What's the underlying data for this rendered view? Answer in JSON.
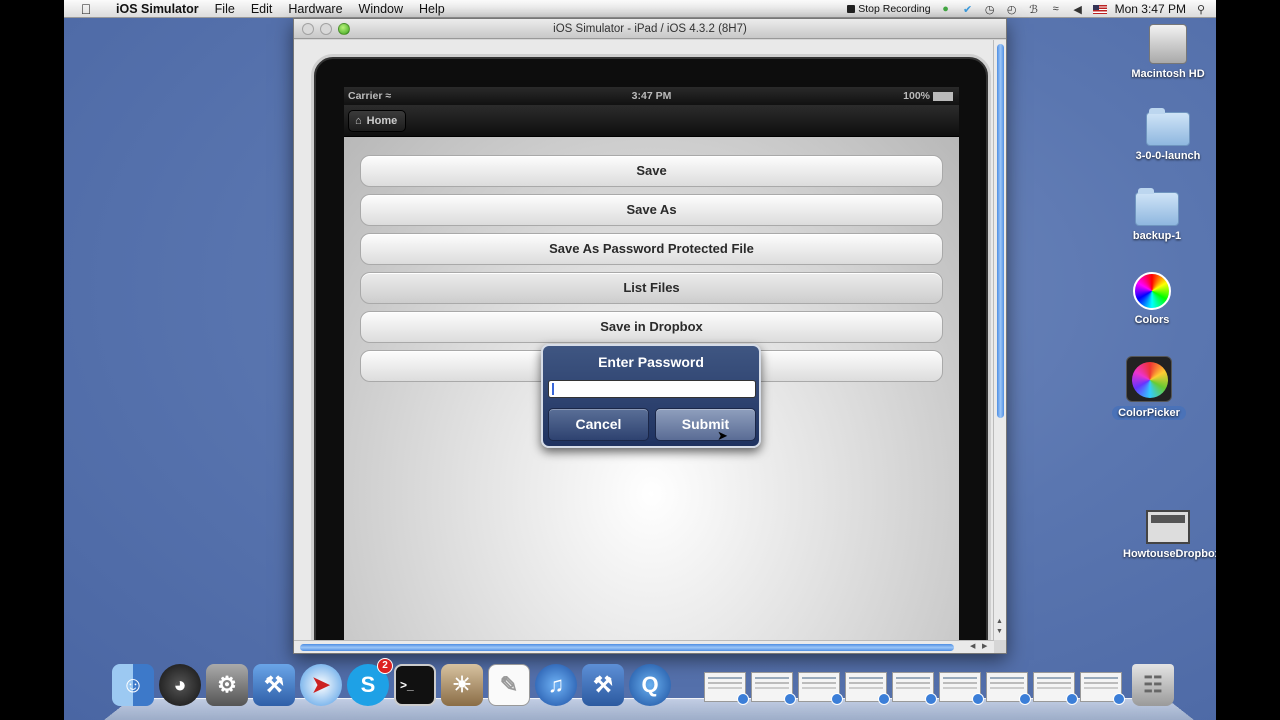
{
  "menubar": {
    "app_name": "iOS Simulator",
    "items": [
      "File",
      "Edit",
      "Hardware",
      "Window",
      "Help"
    ],
    "stop_recording": "Stop Recording",
    "clock": "Mon 3:47 PM"
  },
  "simulator": {
    "window_title": "iOS Simulator - iPad / iOS 4.3.2 (8H7)",
    "statusbar": {
      "carrier": "Carrier",
      "time": "3:47 PM",
      "battery": "100%"
    },
    "navbar": {
      "home_label": "Home"
    },
    "buttons": [
      {
        "label": "Save"
      },
      {
        "label": "Save As"
      },
      {
        "label": "Save As Password Protected File"
      },
      {
        "label": "List Files"
      },
      {
        "label": "Save in Dropbox"
      },
      {
        "label": ""
      }
    ],
    "alert": {
      "title": "Enter Password",
      "input_value": "",
      "cancel_label": "Cancel",
      "submit_label": "Submit"
    }
  },
  "desktop": {
    "icons": [
      {
        "name": "macintosh-hd",
        "label": "Macintosh HD"
      },
      {
        "name": "folder-3-0-0-launch",
        "label": "3-0-0-launch"
      },
      {
        "name": "folder-backup-1",
        "label": "backup-1"
      },
      {
        "name": "colors",
        "label": "Colors"
      },
      {
        "name": "colorpicker",
        "label": "ColorPicker"
      },
      {
        "name": "howtousedropbox",
        "label": "HowtouseDropbox"
      }
    ]
  },
  "dock": {
    "skype_badge": "2",
    "icons": [
      "finder-icon",
      "dashboard-icon",
      "system-preferences-icon",
      "xcode-icon",
      "safari-icon",
      "skype-icon",
      "terminal-icon",
      "preview-icon",
      "textedit-icon",
      "itunes-icon",
      "instruments-icon",
      "quicktime-icon",
      "trash-icon"
    ]
  },
  "colors": {
    "desktop_blue": "#5a76b0",
    "alert_blue": "#2e4270",
    "accent_blue": "#4e8ee3"
  }
}
